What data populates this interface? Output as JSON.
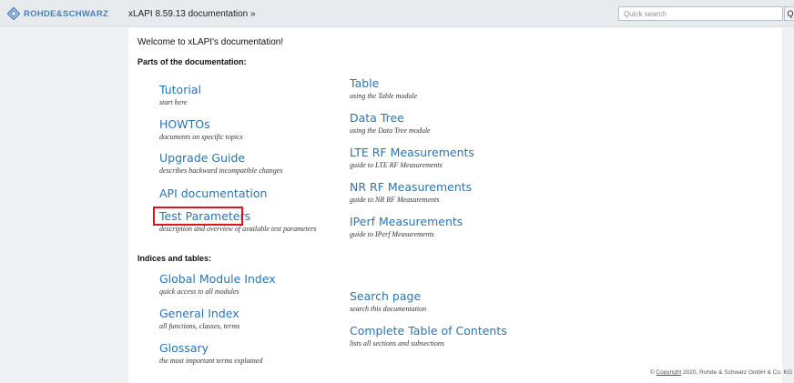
{
  "header": {
    "logo_text": "ROHDE&SCHWARZ",
    "doc_title": "xLAPI 8.59.13 documentation »",
    "search_placeholder": "Quick search",
    "search_button": "Q"
  },
  "main": {
    "welcome": "Welcome to xLAPI's documentation!",
    "parts_heading": "Parts of the documentation:",
    "left_entries": [
      {
        "title": "Tutorial",
        "desc": "start here"
      },
      {
        "title": "HOWTOs",
        "desc": "documents on specific topics"
      },
      {
        "title": "Upgrade Guide",
        "desc": "describes backward incompatible changes"
      },
      {
        "title": "API documentation",
        "desc": ""
      },
      {
        "title": "Test Parameters",
        "desc": "description and overview of available test parameters"
      }
    ],
    "right_entries": [
      {
        "title": "Table",
        "desc": "using the Table module"
      },
      {
        "title": "Data Tree",
        "desc": "using the Data Tree module"
      },
      {
        "title": "LTE RF Measurements",
        "desc": "guide to LTE RF Measurements"
      },
      {
        "title": "NR RF Measurements",
        "desc": "guide to NR RF Measurements"
      },
      {
        "title": "IPerf Measurements",
        "desc": "guide to IPerf Measurements"
      }
    ],
    "indices_heading": "Indices and tables:",
    "indices_left": [
      {
        "title": "Global Module Index",
        "desc": "quick access to all modules"
      },
      {
        "title": "General Index",
        "desc": "all functions, classes, terms"
      },
      {
        "title": "Glossary",
        "desc": "the most important terms explained"
      }
    ],
    "indices_right": [
      {
        "title": "Search page",
        "desc": "search this documentation"
      },
      {
        "title": "Complete Table of Contents",
        "desc": "lists all sections and subsections"
      }
    ]
  },
  "footer": {
    "prefix": "© ",
    "copyright_link": "Copyright",
    "suffix": " 2020, Rohde & Schwarz GmbH & Co. KG"
  },
  "colors": {
    "link": "#2a74b5",
    "brand": "#4a7fbe",
    "highlight_box": "#e0141e",
    "sidebar_bg": "#eef0f3"
  }
}
